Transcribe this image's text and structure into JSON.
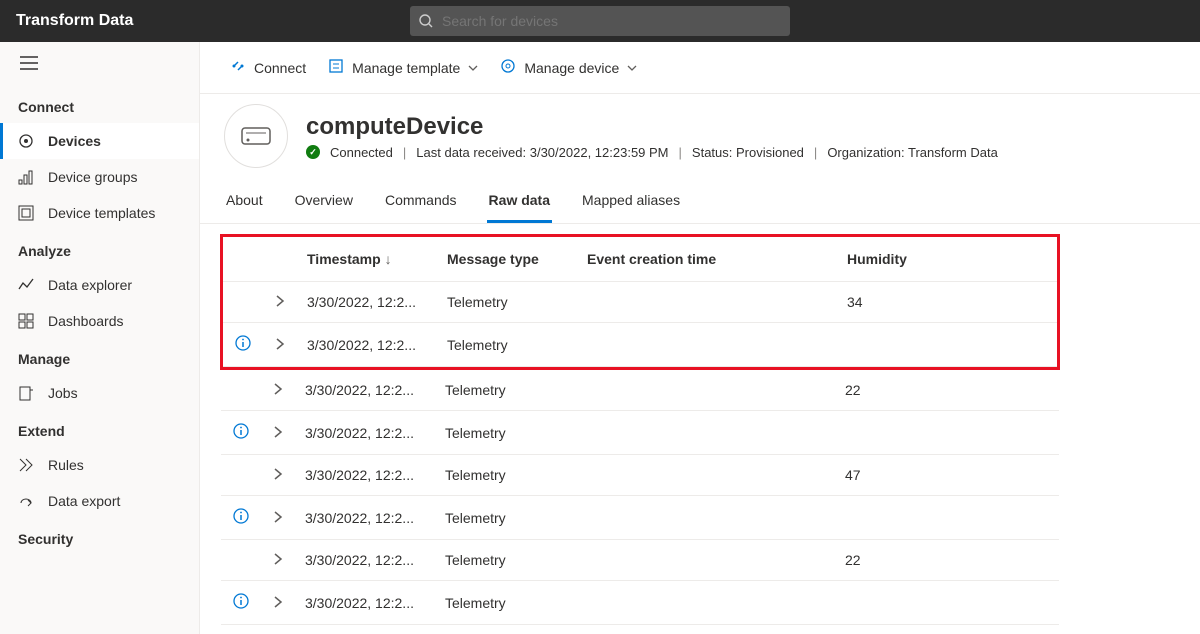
{
  "app": {
    "title": "Transform Data"
  },
  "search": {
    "placeholder": "Search for devices"
  },
  "actions": {
    "connect": "Connect",
    "manage_template": "Manage template",
    "manage_device": "Manage device"
  },
  "sidebar": {
    "connect_header": "Connect",
    "items_connect": [
      {
        "label": "Devices"
      },
      {
        "label": "Device groups"
      },
      {
        "label": "Device templates"
      }
    ],
    "analyze_header": "Analyze",
    "items_analyze": [
      {
        "label": "Data explorer"
      },
      {
        "label": "Dashboards"
      }
    ],
    "manage_header": "Manage",
    "items_manage": [
      {
        "label": "Jobs"
      }
    ],
    "extend_header": "Extend",
    "items_extend": [
      {
        "label": "Rules"
      },
      {
        "label": "Data export"
      }
    ],
    "security_header": "Security"
  },
  "device": {
    "name": "computeDevice",
    "status_label": "Connected",
    "last_data_label": "Last data received: 3/30/2022, 12:23:59 PM",
    "status_text": "Status: Provisioned",
    "org_text": "Organization: Transform Data"
  },
  "tabs": [
    {
      "label": "About"
    },
    {
      "label": "Overview"
    },
    {
      "label": "Commands"
    },
    {
      "label": "Raw data"
    },
    {
      "label": "Mapped aliases"
    }
  ],
  "table": {
    "headers": {
      "timestamp": "Timestamp",
      "sort_arrow": "↓",
      "message_type": "Message type",
      "event_creation": "Event creation time",
      "humidity": "Humidity"
    },
    "rows": [
      {
        "info": false,
        "timestamp": "3/30/2022, 12:2...",
        "message_type": "Telemetry",
        "event_creation": "",
        "humidity": "34"
      },
      {
        "info": true,
        "timestamp": "3/30/2022, 12:2...",
        "message_type": "Telemetry",
        "event_creation": "",
        "humidity": ""
      },
      {
        "info": false,
        "timestamp": "3/30/2022, 12:2...",
        "message_type": "Telemetry",
        "event_creation": "",
        "humidity": "22"
      },
      {
        "info": true,
        "timestamp": "3/30/2022, 12:2...",
        "message_type": "Telemetry",
        "event_creation": "",
        "humidity": ""
      },
      {
        "info": false,
        "timestamp": "3/30/2022, 12:2...",
        "message_type": "Telemetry",
        "event_creation": "",
        "humidity": "47"
      },
      {
        "info": true,
        "timestamp": "3/30/2022, 12:2...",
        "message_type": "Telemetry",
        "event_creation": "",
        "humidity": ""
      },
      {
        "info": false,
        "timestamp": "3/30/2022, 12:2...",
        "message_type": "Telemetry",
        "event_creation": "",
        "humidity": "22"
      },
      {
        "info": true,
        "timestamp": "3/30/2022, 12:2...",
        "message_type": "Telemetry",
        "event_creation": "",
        "humidity": ""
      }
    ]
  }
}
